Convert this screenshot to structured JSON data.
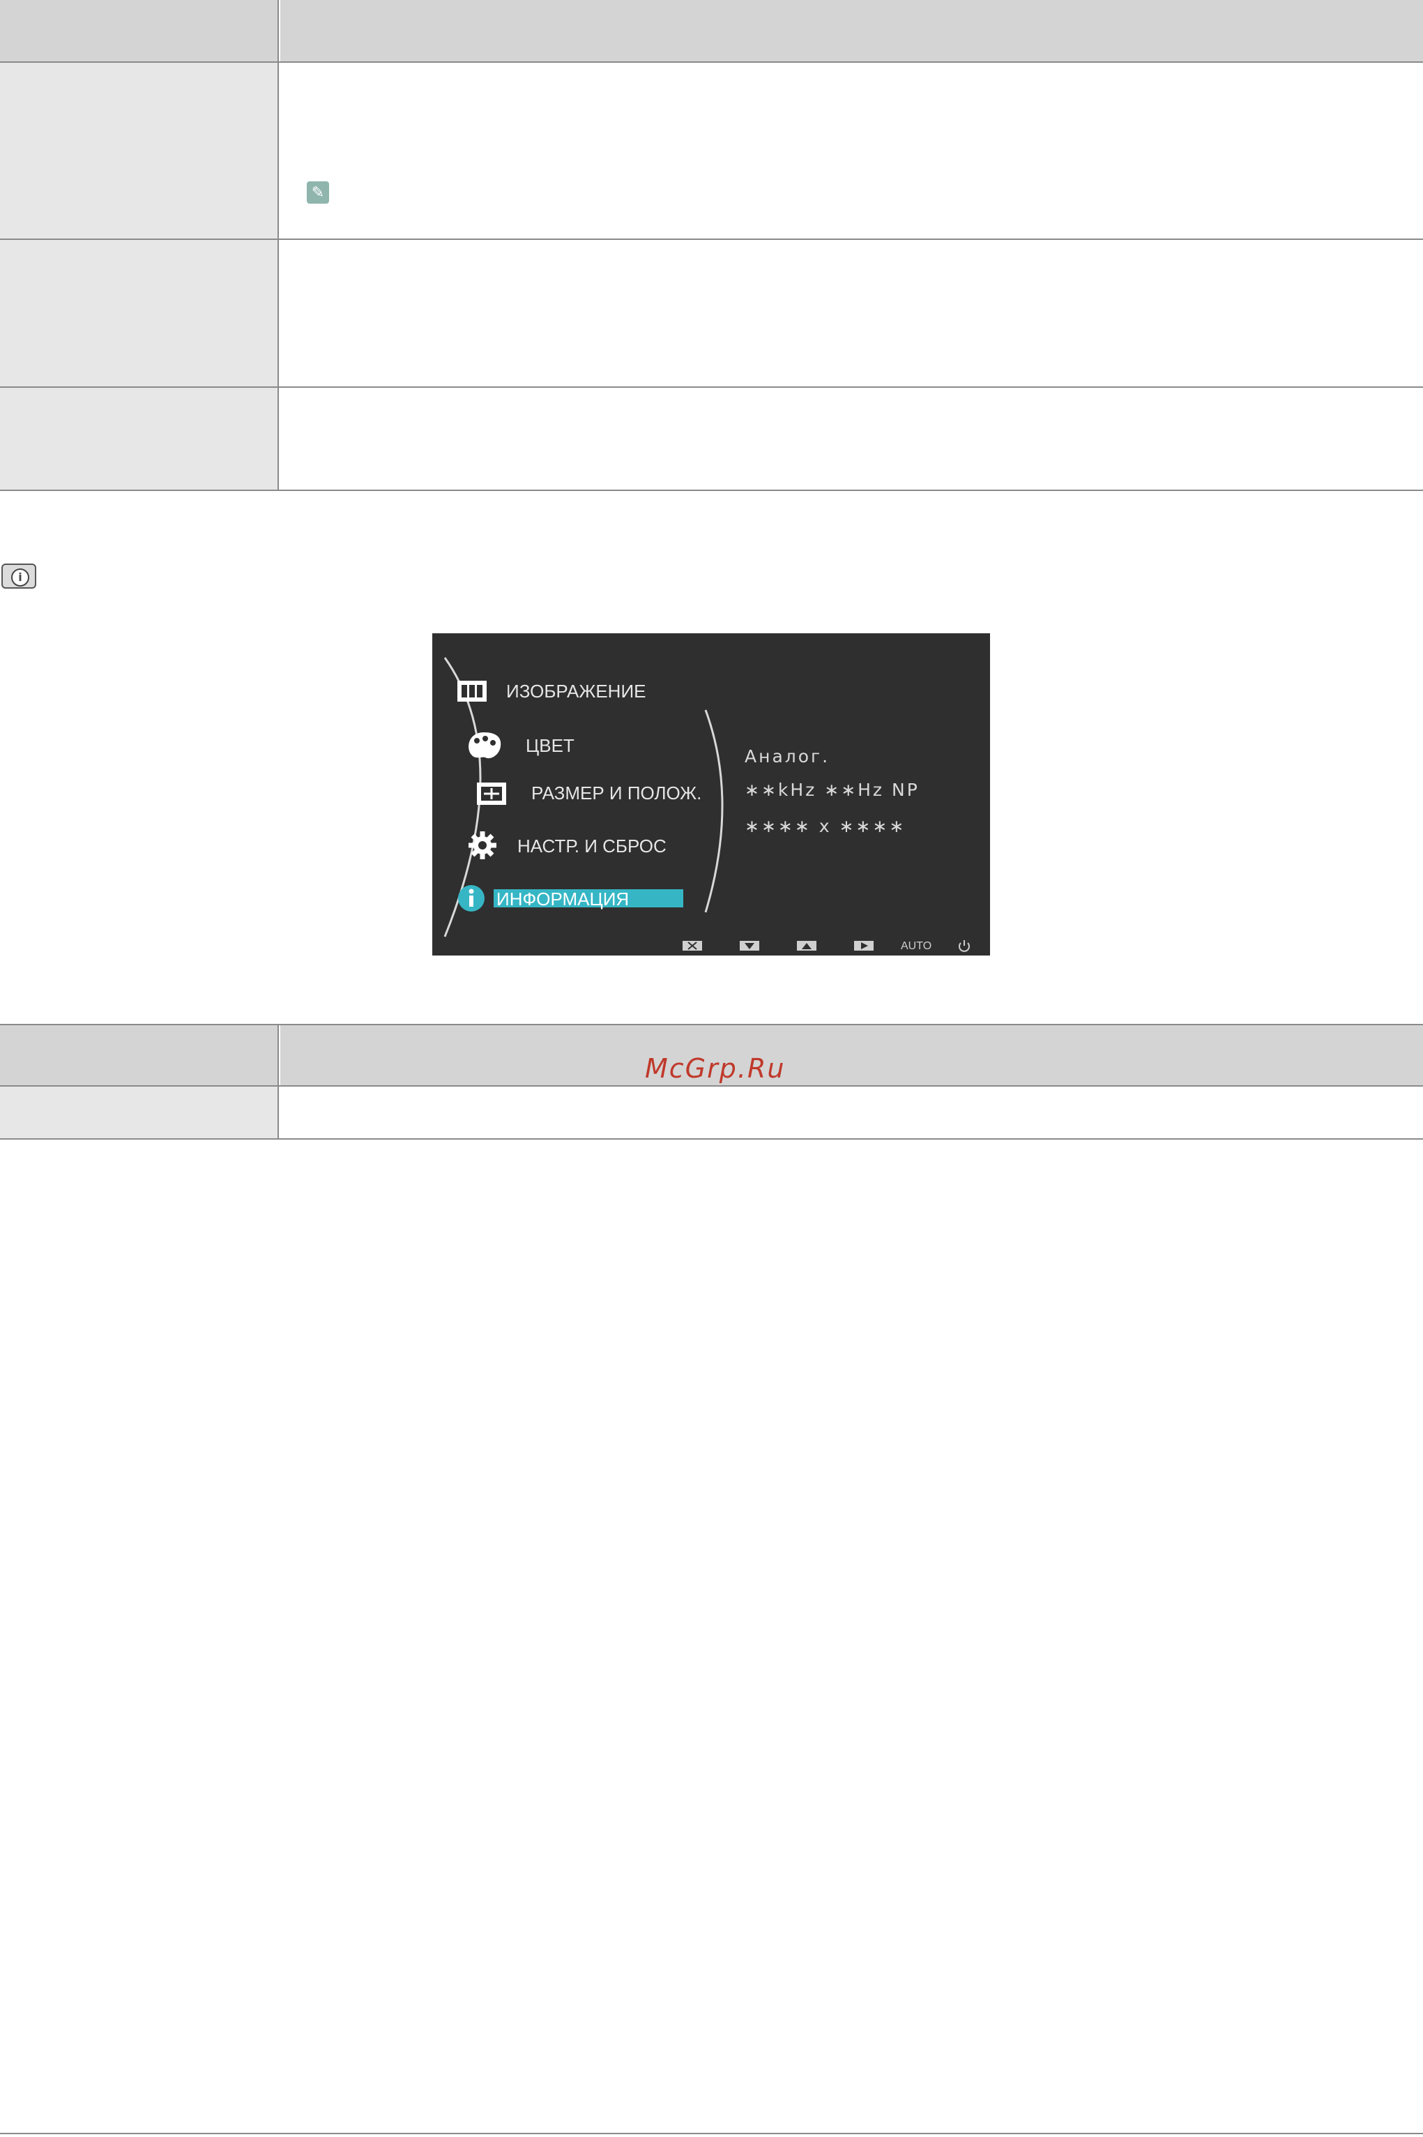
{
  "osd": {
    "menu": [
      {
        "label": "ИЗОБРАЖЕНИЕ",
        "icon": "picture-bars-icon"
      },
      {
        "label": "ЦВЕТ",
        "icon": "palette-icon"
      },
      {
        "label": "РАЗМЕР И ПОЛОЖ.",
        "icon": "size-position-icon"
      },
      {
        "label": "НАСТР. И СБРОС",
        "icon": "gear-icon"
      },
      {
        "label": "ИНФОРМАЦИЯ",
        "icon": "info-icon",
        "selected": true
      }
    ],
    "info_lines": [
      "Аналог.",
      "∗∗kHz ∗∗Hz NP",
      "∗∗∗∗ x ∗∗∗∗"
    ],
    "buttons": [
      "exit-icon",
      "down-icon",
      "up-icon",
      "enter-icon",
      "AUTO",
      "power-icon"
    ],
    "auto_label": "AUTO",
    "accent": "#36b6c5"
  },
  "watermark": "McGrp.Ru"
}
